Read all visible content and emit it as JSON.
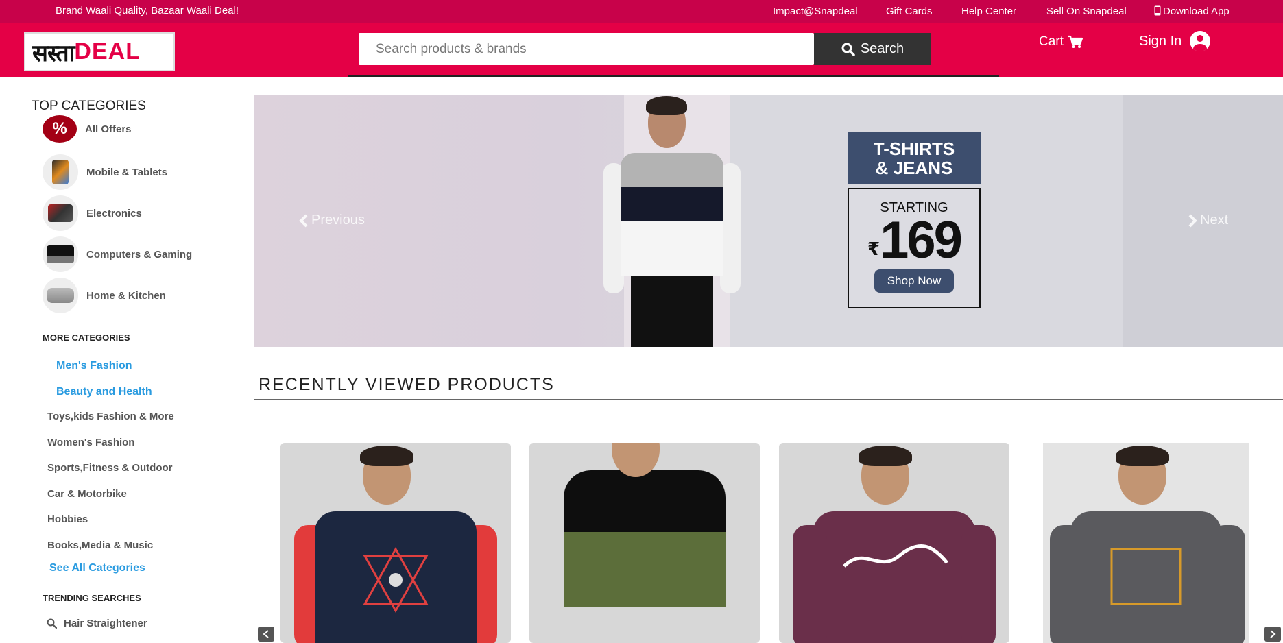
{
  "topbar": {
    "tagline": "Brand Waali Quality, Bazaar Waali Deal!",
    "links": [
      "Impact@Snapdeal",
      "Gift Cards",
      "Help Center",
      "Sell On Snapdeal",
      "Download App"
    ]
  },
  "header": {
    "logo_hindi": "सस्ता",
    "logo_deal": "DEAL",
    "search_placeholder": "Search products & brands",
    "search_button": "Search",
    "cart_label": "Cart",
    "signin_label": "Sign In"
  },
  "sidebar": {
    "top_heading": "TOP CATEGORIES",
    "top_categories": [
      {
        "label": "All Offers",
        "icon": "percent-icon"
      },
      {
        "label": "Mobile & Tablets",
        "icon": "mobile-icon"
      },
      {
        "label": "Electronics",
        "icon": "electronics-icon"
      },
      {
        "label": "Computers & Gaming",
        "icon": "laptop-icon"
      },
      {
        "label": "Home & Kitchen",
        "icon": "sofa-icon"
      }
    ],
    "more_heading": "MORE CATEGORIES",
    "more_categories": [
      "Men's Fashion",
      "Beauty and Health",
      "Toys,kids Fashion & More",
      "Women's Fashion",
      "Sports,Fitness & Outdoor",
      "Car & Motorbike",
      "Hobbies",
      "Books,Media & Music"
    ],
    "see_all": "See All Categories",
    "trending_heading": "TRENDING SEARCHES",
    "trending": [
      "Hair Straightener"
    ]
  },
  "banner": {
    "promo_title_line1": "T-SHIRTS",
    "promo_title_line2": "& JEANS",
    "starting": "STARTING",
    "currency": "₹",
    "price": "169",
    "cta": "Shop Now",
    "prev_label": "Previous",
    "next_label": "Next"
  },
  "recently_viewed": {
    "title": "RECENTLY VIEWED PRODUCTS"
  },
  "colors": {
    "topbar": "#c8024a",
    "header": "#e40046",
    "link_blue": "#2a9be0",
    "search_button": "#333333"
  }
}
